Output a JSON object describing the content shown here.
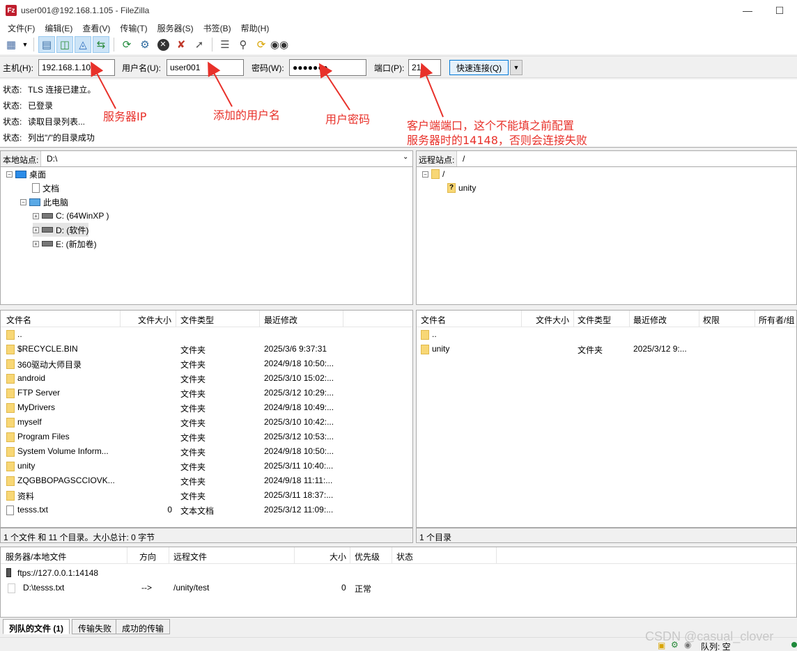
{
  "window": {
    "title": "user001@192.168.1.105 - FileZilla",
    "app_icon_letter": "Fz"
  },
  "menu": [
    "文件(F)",
    "编辑(E)",
    "查看(V)",
    "传输(T)",
    "服务器(S)",
    "书签(B)",
    "帮助(H)"
  ],
  "quickconnect": {
    "host_label": "主机(H):",
    "host_value": "192.168.1.105",
    "user_label": "用户名(U):",
    "user_value": "user001",
    "pass_label": "密码(W):",
    "pass_value": "●●●●●●●",
    "port_label": "端口(P):",
    "port_value": "21",
    "button_label": "快速连接(Q)"
  },
  "log": [
    {
      "tag": "状态:",
      "text": "TLS 连接已建立。"
    },
    {
      "tag": "状态:",
      "text": "已登录"
    },
    {
      "tag": "状态:",
      "text": "读取目录列表..."
    },
    {
      "tag": "状态:",
      "text": "列出\"/\"的目录成功"
    }
  ],
  "annotations": {
    "server_ip": "服务器IP",
    "username": "添加的用户名",
    "password": "用户密码",
    "port_line1": "客户端端口，这个不能填之前配置",
    "port_line2": "服务器时的14148，否则会连接失败"
  },
  "local": {
    "site_label": "本地站点:",
    "path": "D:\\",
    "tree": [
      {
        "label": "桌面"
      },
      {
        "label": "文档"
      },
      {
        "label": "此电脑"
      },
      {
        "label": "C: (64WinXP )"
      },
      {
        "label": "D: (软件)"
      },
      {
        "label": "E: (新加卷)"
      }
    ],
    "columns": [
      "文件名",
      "文件大小",
      "文件类型",
      "最近修改"
    ],
    "files": [
      {
        "name": "..",
        "size": "",
        "type": "",
        "modified": "",
        "kind": "folder"
      },
      {
        "name": "$RECYCLE.BIN",
        "size": "",
        "type": "文件夹",
        "modified": "2025/3/6 9:37:31",
        "kind": "folder"
      },
      {
        "name": "360驱动大师目录",
        "size": "",
        "type": "文件夹",
        "modified": "2024/9/18 10:50:...",
        "kind": "folder"
      },
      {
        "name": "android",
        "size": "",
        "type": "文件夹",
        "modified": "2025/3/10 15:02:...",
        "kind": "folder"
      },
      {
        "name": "FTP Server",
        "size": "",
        "type": "文件夹",
        "modified": "2025/3/12 10:29:...",
        "kind": "folder"
      },
      {
        "name": "MyDrivers",
        "size": "",
        "type": "文件夹",
        "modified": "2024/9/18 10:49:...",
        "kind": "folder"
      },
      {
        "name": "myself",
        "size": "",
        "type": "文件夹",
        "modified": "2025/3/10 10:42:...",
        "kind": "folder"
      },
      {
        "name": "Program Files",
        "size": "",
        "type": "文件夹",
        "modified": "2025/3/12 10:53:...",
        "kind": "folder"
      },
      {
        "name": "System Volume Inform...",
        "size": "",
        "type": "文件夹",
        "modified": "2024/9/18 10:50:...",
        "kind": "folder"
      },
      {
        "name": "unity",
        "size": "",
        "type": "文件夹",
        "modified": "2025/3/11 10:40:...",
        "kind": "folder"
      },
      {
        "name": "ZQGBBOPAGSCCIOVK...",
        "size": "",
        "type": "文件夹",
        "modified": "2024/9/18 11:11:...",
        "kind": "folder"
      },
      {
        "name": "资料",
        "size": "",
        "type": "文件夹",
        "modified": "2025/3/11 18:37:...",
        "kind": "folder"
      },
      {
        "name": "tesss.txt",
        "size": "0",
        "type": "文本文档",
        "modified": "2025/3/12 11:09:...",
        "kind": "file"
      }
    ],
    "status": "1 个文件 和 11 个目录。大小总计: 0 字节"
  },
  "remote": {
    "site_label": "远程站点:",
    "path": "/",
    "tree": [
      {
        "label": "/"
      },
      {
        "label": "unity"
      }
    ],
    "columns": [
      "文件名",
      "文件大小",
      "文件类型",
      "最近修改",
      "权限",
      "所有者/组"
    ],
    "files": [
      {
        "name": "..",
        "size": "",
        "type": "",
        "modified": "",
        "kind": "folder"
      },
      {
        "name": "unity",
        "size": "",
        "type": "文件夹",
        "modified": "2025/3/12 9:...",
        "kind": "folder"
      }
    ],
    "status": "1 个目录"
  },
  "queue": {
    "columns": [
      "服务器/本地文件",
      "方向",
      "远程文件",
      "大小",
      "优先级",
      "状态"
    ],
    "server": "ftps://127.0.0.1:14148",
    "item": {
      "local": "D:\\tesss.txt",
      "direction": "-->",
      "remote": "/unity/test",
      "size": "0",
      "priority": "正常"
    },
    "tabs": [
      "列队的文件 (1)",
      "传输失败",
      "成功的传输"
    ],
    "status_text": "队列: 空"
  },
  "watermark": "CSDN @casual_clover"
}
